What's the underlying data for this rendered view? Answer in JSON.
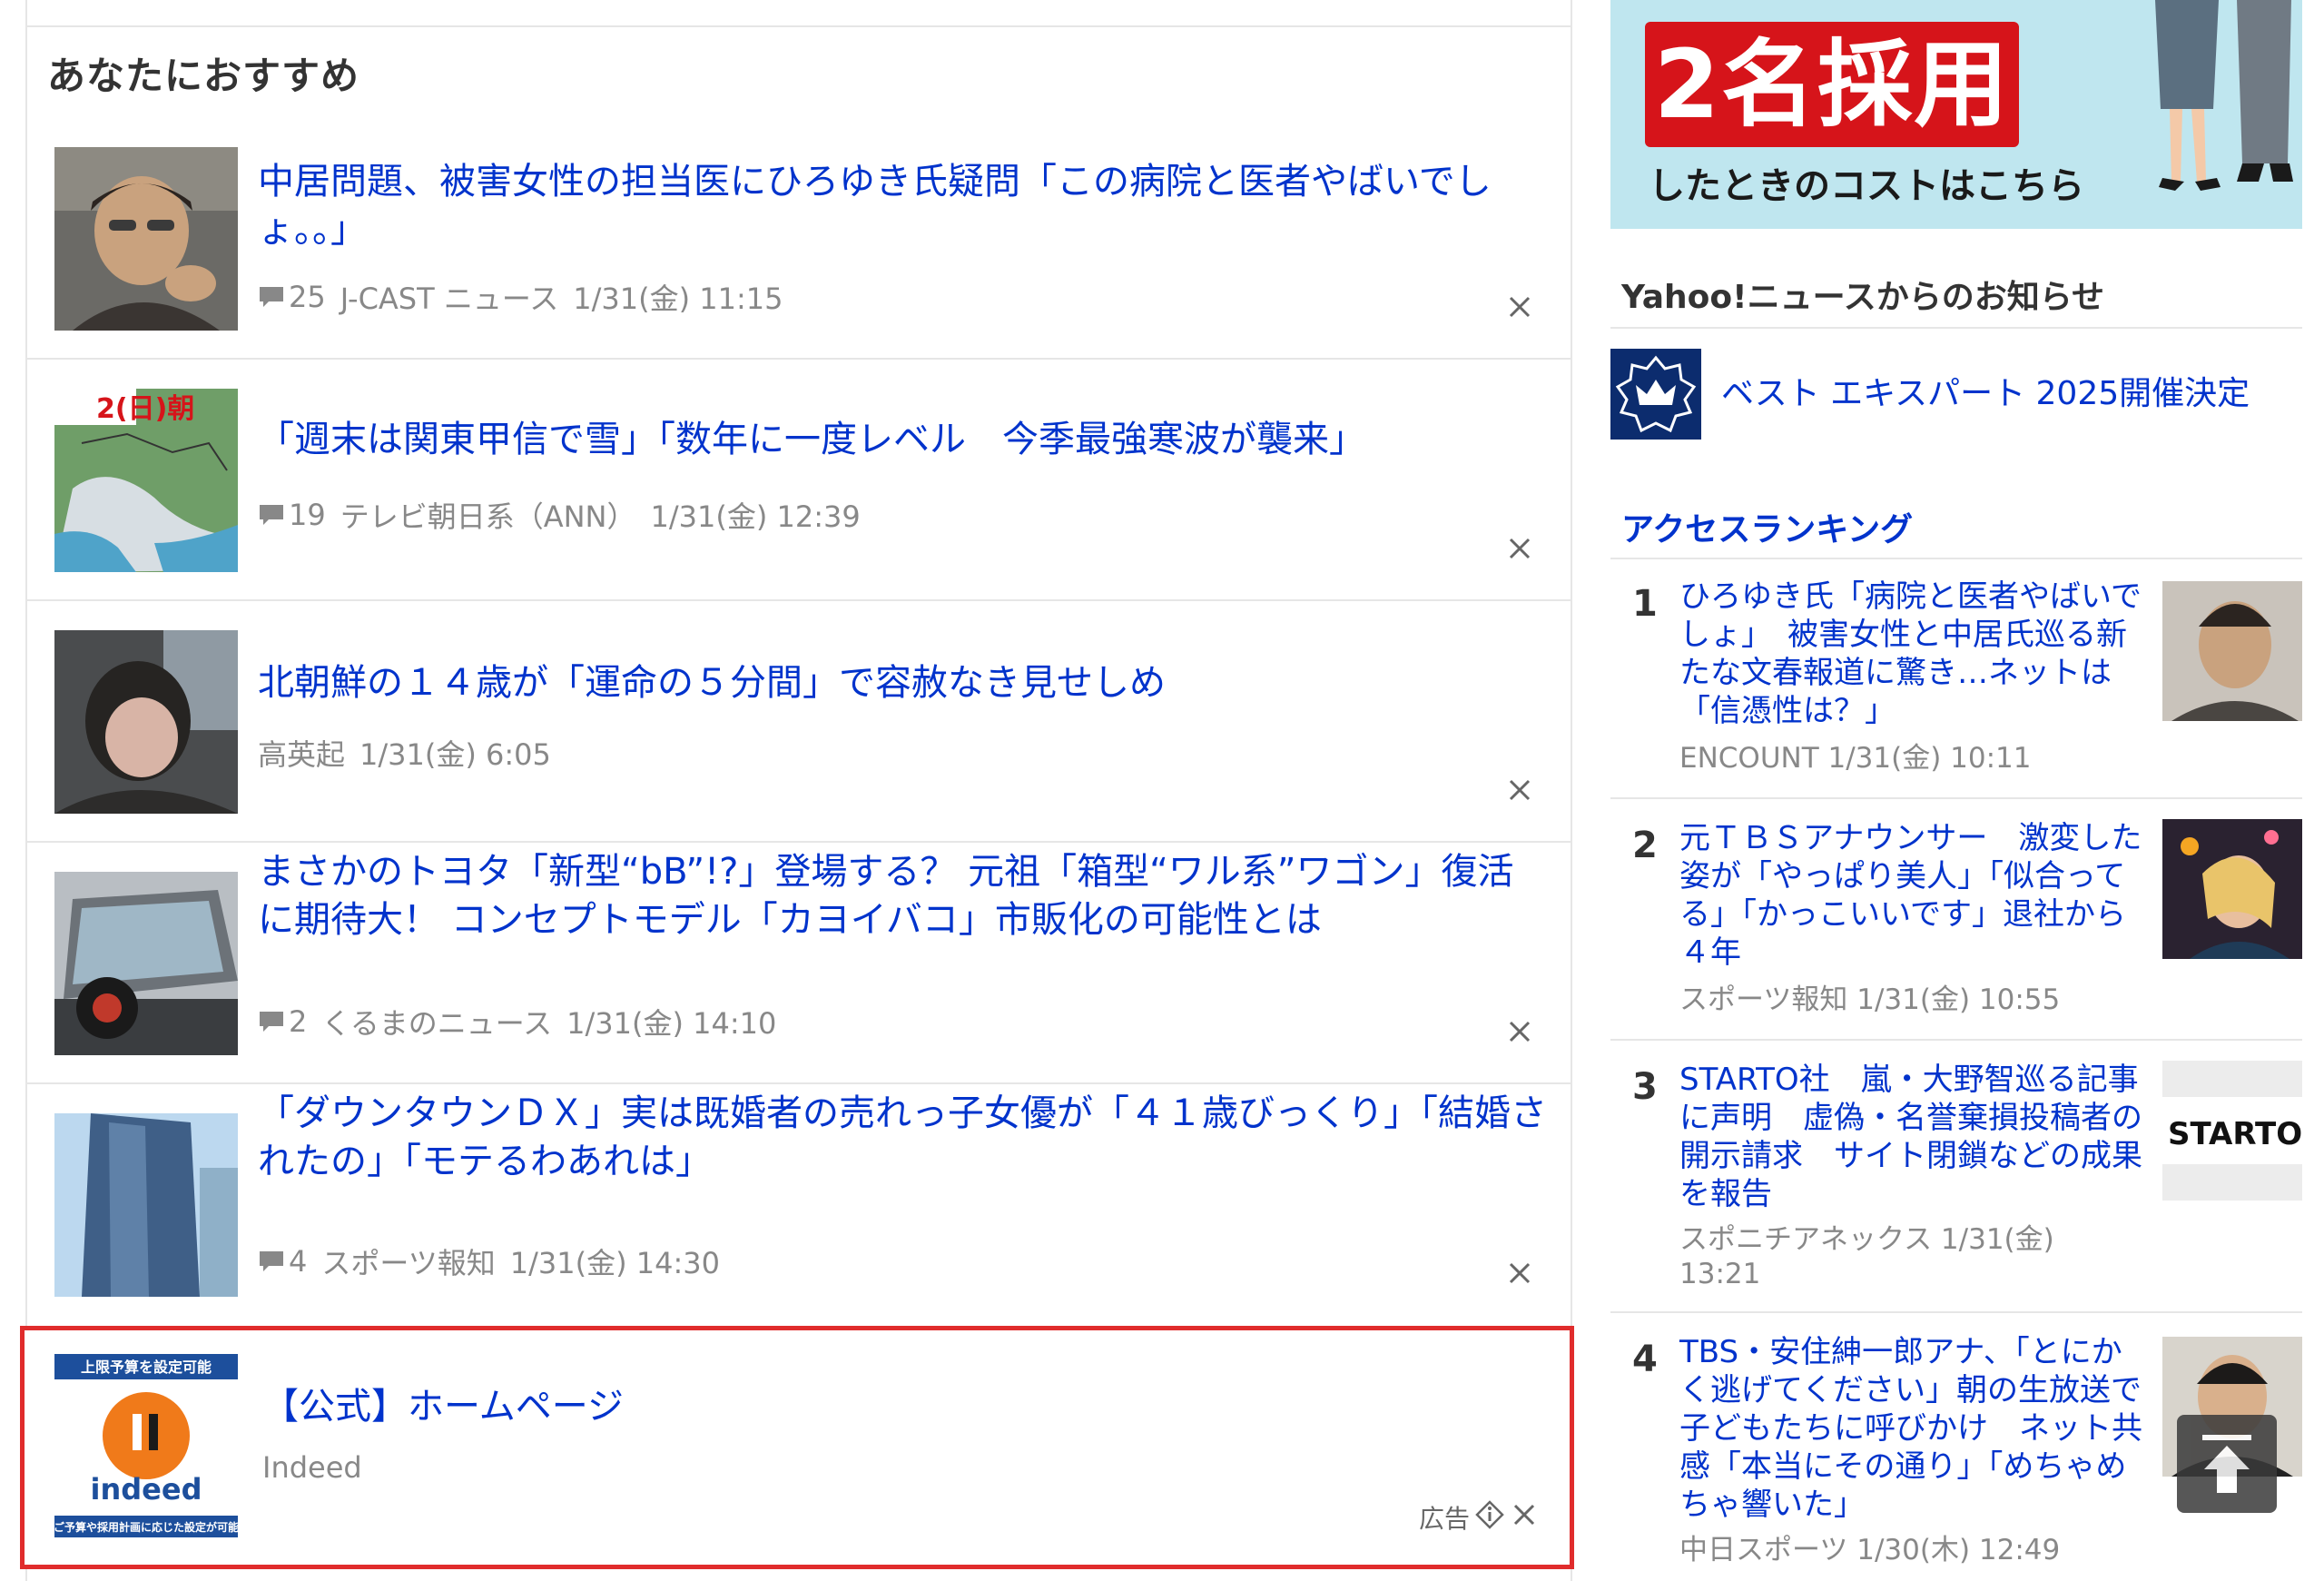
{
  "section_title": "あなたにおすすめ",
  "articles": [
    {
      "title": "中居問題、被害女性の担当医にひろゆき氏疑問「この病院と医者やばいでしょ。。」",
      "comments": "25",
      "source": "J-CAST ニュース",
      "date": "1/31(金) 11:15"
    },
    {
      "title": "「週末は関東甲信で雪」「数年に一度レベル　今季最強寒波が襲来」",
      "comments": "19",
      "source": "テレビ朝日系（ANN）",
      "date": "1/31(金) 12:39",
      "thumb_text": "2(日)朝"
    },
    {
      "title": "北朝鮮の１４歳が「運命の５分間」で容赦なき見せしめ",
      "source": "高英起",
      "date": "1/31(金) 6:05"
    },
    {
      "title": "まさかのトヨタ「新型“bB”!?」登場する？ 元祖「箱型“ワル系”ワゴン」復活に期待大！ コンセプトモデル「カヨイバコ」市販化の可能性とは",
      "comments": "2",
      "source": "くるまのニュース",
      "date": "1/31(金) 14:10"
    },
    {
      "title": "「ダウンタウンＤＸ」実は既婚者の売れっ子女優が「４１歳びっくり」「結婚されたの」「モテるわあれは」",
      "comments": "4",
      "source": "スポーツ報知",
      "date": "1/31(金) 14:30"
    }
  ],
  "ad": {
    "title": "【公式】ホームページ",
    "advertiser": "Indeed",
    "label": "広告",
    "thumb_top": "上限予算を設定可能",
    "thumb_brand": "indeed",
    "thumb_bottom": "ご予算や採用計画に応じた設定が可能"
  },
  "banner": {
    "big": "2名採用",
    "sub": "したときのコストはこちら"
  },
  "notice": {
    "heading": "Yahoo!ニュースからのお知らせ",
    "item": "ベスト エキスパート 2025開催決定"
  },
  "ranking": {
    "heading": "アクセスランキング",
    "items": [
      {
        "rank": "1",
        "title": "ひろゆき氏「病院と医者やばいでしょ」　被害女性と中居氏巡る新たな文春報道に驚き…ネットは「信憑性は？」",
        "meta": "ENCOUNT 1/31(金) 10:11"
      },
      {
        "rank": "2",
        "title": "元ＴＢＳアナウンサー　激変した姿が「やっぱり美人」「似合ってる」「かっこいいです」退社から４年",
        "meta": "スポーツ報知 1/31(金) 10:55"
      },
      {
        "rank": "3",
        "title": "STARTO社　嵐・大野智巡る記事に声明　虚偽・名誉棄損投稿者の開示請求　サイト閉鎖などの成果を報告",
        "meta": "スポニチアネックス 1/31(金) 13:21",
        "thumb_text": "STARTO ENTE"
      },
      {
        "rank": "4",
        "title": "TBS・安住紳一郎アナ、「とにかく逃げてください」朝の生放送で子どもたちに呼びかけ　ネット共感「本当にその通り」「めちゃめちゃ響いた」",
        "meta": "中日スポーツ 1/30(木) 12:49"
      }
    ]
  },
  "colors": {
    "link": "#0033cc",
    "ad_border": "#e02c2c",
    "meta": "#888888"
  }
}
